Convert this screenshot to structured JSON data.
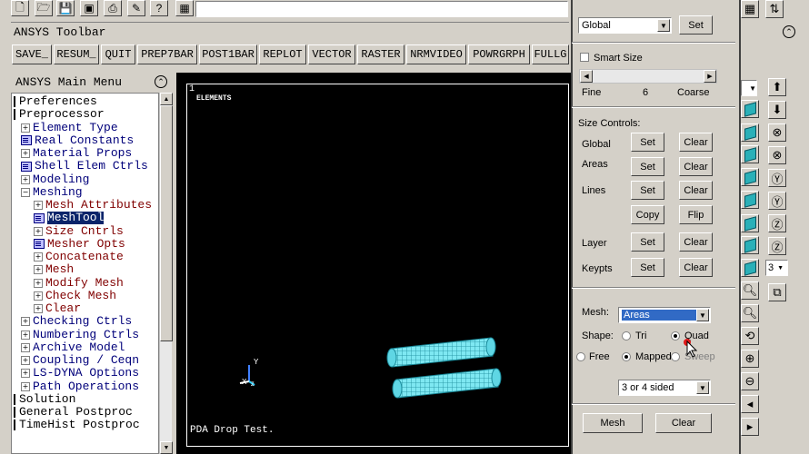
{
  "top_toolbar": {
    "icons": [
      "new-file-icon",
      "open-folder-icon",
      "save-icon",
      "report-icon",
      "print-icon",
      "edit-icon",
      "help-icon",
      "calculator-icon"
    ]
  },
  "ansys_toolbar": {
    "title": "ANSYS Toolbar",
    "buttons": [
      "SAVE_",
      "RESUM_",
      "QUIT",
      "PREP7BAR",
      "POST1BAR",
      "REPLOT",
      "VECTOR",
      "RASTER",
      "NRMVIDEO",
      "POWRGRPH",
      "FULLG"
    ]
  },
  "main_menu": {
    "title": "ANSYS Main Menu",
    "items": [
      {
        "label": "Preferences",
        "type": "sq"
      },
      {
        "label": "Preprocessor",
        "type": "sq"
      },
      {
        "label": "Element Type",
        "type": "plus"
      },
      {
        "label": "Real Constants",
        "type": "gly"
      },
      {
        "label": "Material Props",
        "type": "plus"
      },
      {
        "label": "Shell Elem Ctrls",
        "type": "gly"
      },
      {
        "label": "Modeling",
        "type": "plus"
      },
      {
        "label": "Meshing",
        "type": "minus"
      },
      {
        "label": "Mesh Attributes",
        "type": "plus"
      },
      {
        "label": "MeshTool",
        "type": "gly"
      },
      {
        "label": "Size Cntrls",
        "type": "plus"
      },
      {
        "label": "Mesher Opts",
        "type": "gly"
      },
      {
        "label": "Concatenate",
        "type": "plus"
      },
      {
        "label": "Mesh",
        "type": "plus"
      },
      {
        "label": "Modify Mesh",
        "type": "plus"
      },
      {
        "label": "Check Mesh",
        "type": "plus"
      },
      {
        "label": "Clear",
        "type": "plus"
      },
      {
        "label": "Checking Ctrls",
        "type": "plus"
      },
      {
        "label": "Numbering Ctrls",
        "type": "plus"
      },
      {
        "label": "Archive Model",
        "type": "plus"
      },
      {
        "label": "Coupling / Ceqn",
        "type": "plus"
      },
      {
        "label": "LS-DYNA Options",
        "type": "plus"
      },
      {
        "label": "Path Operations",
        "type": "plus"
      },
      {
        "label": "Solution",
        "type": "sq"
      },
      {
        "label": "General Postproc",
        "type": "sq"
      },
      {
        "label": "TimeHist Postproc",
        "type": "sq"
      }
    ]
  },
  "graphics": {
    "window_number": "1",
    "label": "ELEMENTS",
    "footer": "PDA Drop Test.",
    "triad_x": "X",
    "triad_y": "Y",
    "triad_z": "Z"
  },
  "meshtool": {
    "element_attributes": "Global",
    "set_label": "Set",
    "smart_size_label": "Smart Size",
    "smart_size_checked": false,
    "fine_label": "Fine",
    "slider_value": "6",
    "coarse_label": "Coarse",
    "size_controls_label": "Size Controls:",
    "size_rows": [
      {
        "label": "Global",
        "btn1": "Set",
        "btn2": "Clear"
      },
      {
        "label": "Areas",
        "btn1": "Set",
        "btn2": "Clear"
      },
      {
        "label": "Lines",
        "btn1": "Set",
        "btn2": "Clear"
      },
      {
        "label": "",
        "btn1": "Copy",
        "btn2": "Flip"
      },
      {
        "label": "Layer",
        "btn1": "Set",
        "btn2": "Clear"
      },
      {
        "label": "Keypts",
        "btn1": "Set",
        "btn2": "Clear"
      }
    ],
    "mesh_label": "Mesh:",
    "mesh_value": "Areas",
    "shape_label": "Shape:",
    "shape_tri": "Tri",
    "shape_quad": "Quad",
    "shape_selected": "Quad",
    "free_label": "Free",
    "mapped_label": "Mapped",
    "sweep_label": "Sweep",
    "mesher_selected": "Mapped",
    "sided_value": "3 or 4 sided",
    "mesh_button": "Mesh",
    "clear_button": "Clear"
  },
  "right_toolbar": {
    "view_number": "3"
  },
  "colors": {
    "graphics_bg": "#000000",
    "mesh": "#40e0f0",
    "highlight": "#0a246a"
  }
}
